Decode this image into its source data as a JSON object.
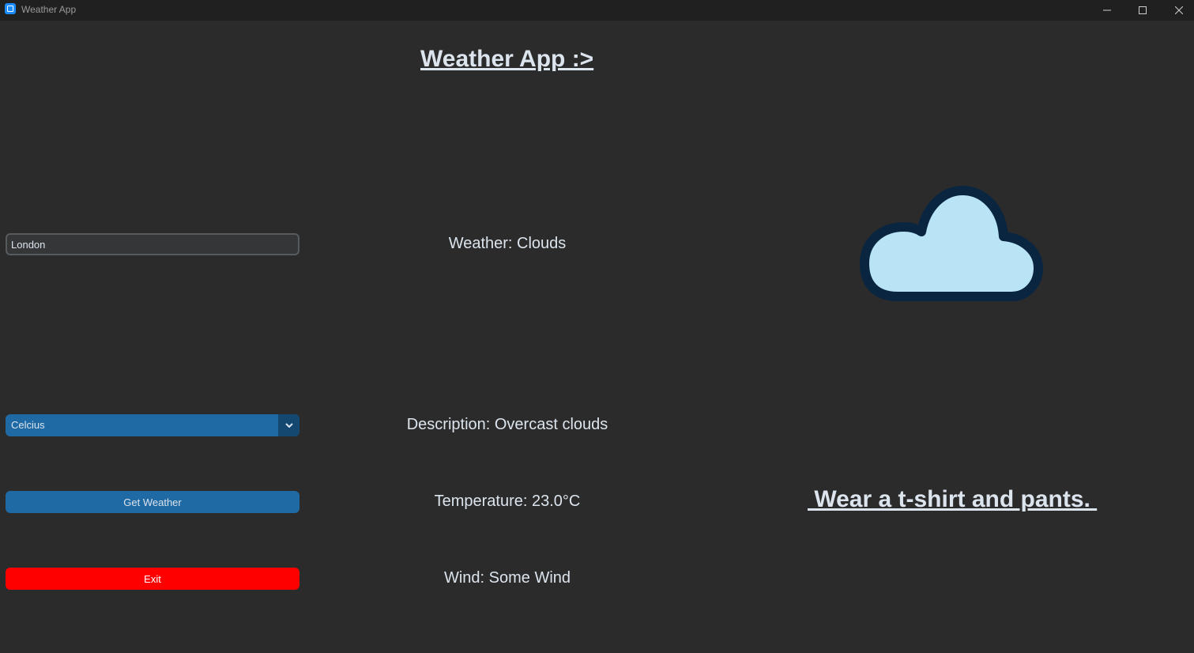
{
  "window": {
    "title": "Weather App",
    "icons": {
      "app": "app-icon",
      "minimize": "minimize-icon",
      "maximize": "maximize-icon",
      "close": "close-icon"
    }
  },
  "header": {
    "title": "Weather App :>"
  },
  "form": {
    "city_value": "London",
    "unit_selected": "Celcius",
    "get_weather_label": "Get Weather",
    "exit_label": "Exit"
  },
  "info": {
    "weather": "Weather: Clouds",
    "description": "Description: Overcast clouds",
    "temperature": "Temperature: 23.0°C",
    "wind": "Wind: Some Wind"
  },
  "weather_icon": "cloud-icon",
  "advice": " Wear a t-shirt and pants. ",
  "colors": {
    "background": "#2b2b2b",
    "titlebar": "#202020",
    "text": "#dce4ee",
    "accent": "#1f6aa5",
    "accent_dark": "#144870",
    "exit": "#ff0000",
    "cloud_fill": "#b8e4f5",
    "cloud_stroke": "#0a2540"
  }
}
